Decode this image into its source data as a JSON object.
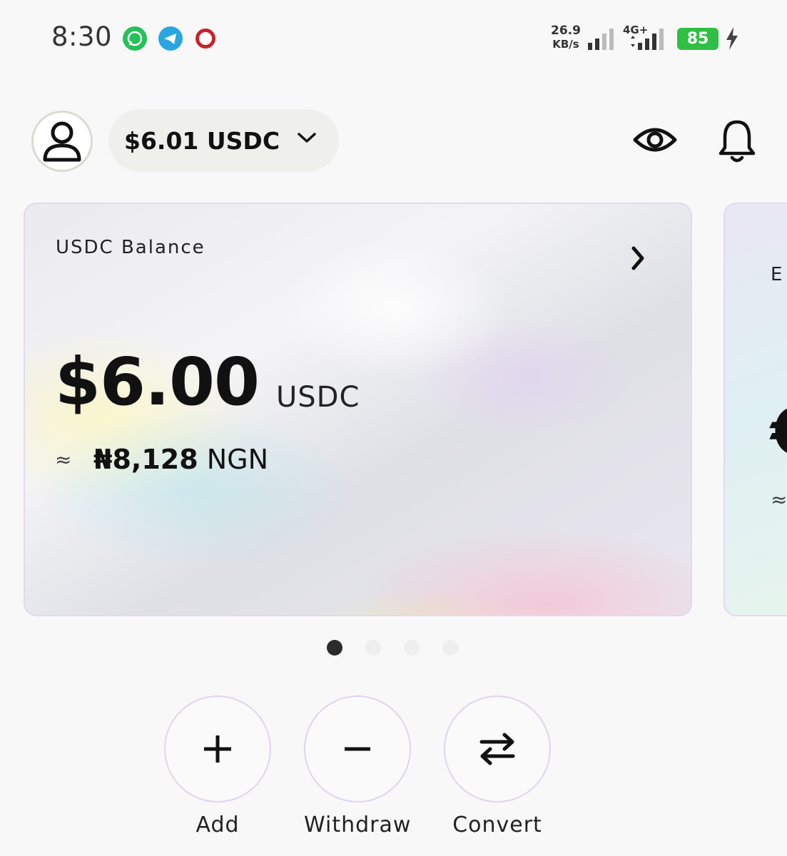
{
  "status_bar": {
    "time": "8:30",
    "apps": [
      "whatsapp-icon",
      "telegram-icon",
      "opera-icon"
    ],
    "net_speed_value": "26.9",
    "net_speed_unit": "KB/s",
    "network_type": "4G+",
    "battery": "85",
    "colors": {
      "whatsapp": "#25c15a",
      "telegram": "#2aa6e0",
      "opera": "#c8222c",
      "battery": "#2fbf44"
    }
  },
  "header": {
    "total_balance": "$6.01 USDC",
    "icons": [
      "avatar-icon",
      "chevron-down-icon",
      "eye-icon",
      "bell-icon"
    ]
  },
  "card": {
    "label": "USDC Balance",
    "amount": "$6.00",
    "currency": "USDC",
    "approx_symbol": "≈",
    "local_amount": "₦8,128",
    "local_currency": "NGN"
  },
  "next_card": {
    "label": "E",
    "amount": "€",
    "approx_symbol": "≈"
  },
  "pager": {
    "count": 4,
    "active_index": 0
  },
  "actions": [
    {
      "label": "Add",
      "icon": "plus-icon"
    },
    {
      "label": "Withdraw",
      "icon": "minus-icon"
    },
    {
      "label": "Convert",
      "icon": "swap-arrows-icon"
    }
  ]
}
